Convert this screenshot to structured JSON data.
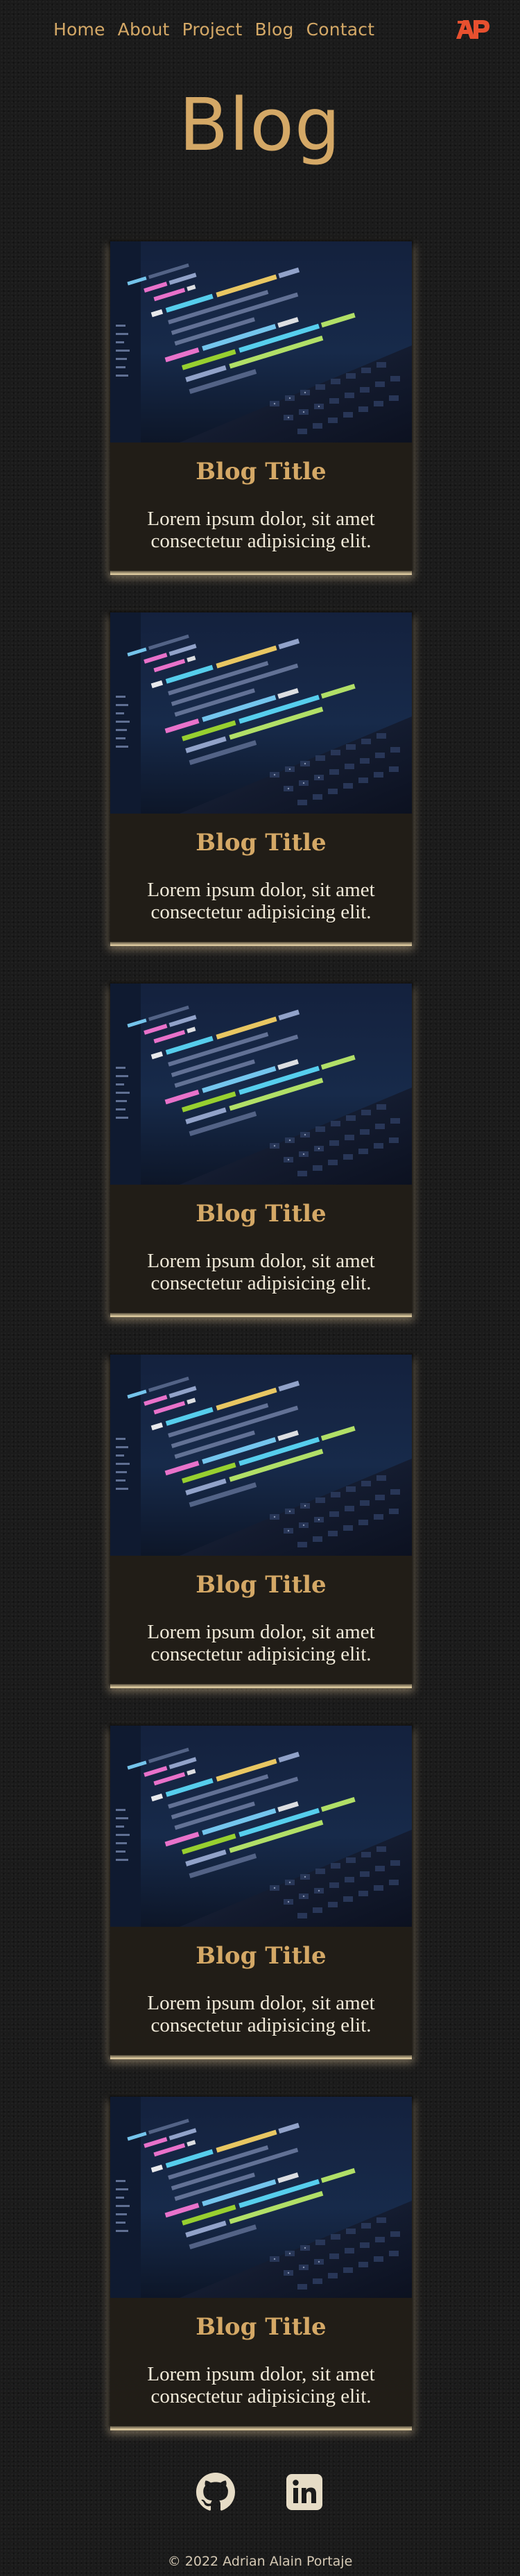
{
  "nav": {
    "items": [
      {
        "label": "Home"
      },
      {
        "label": "About"
      },
      {
        "label": "Project"
      },
      {
        "label": "Blog"
      },
      {
        "label": "Contact"
      }
    ],
    "logo_text": "AP"
  },
  "page": {
    "title": "Blog"
  },
  "posts": [
    {
      "title": "Blog Title",
      "text": "Lorem ipsum dolor, sit amet consectetur adipisicing elit."
    },
    {
      "title": "Blog Title",
      "text": "Lorem ipsum dolor, sit amet consectetur adipisicing elit."
    },
    {
      "title": "Blog Title",
      "text": "Lorem ipsum dolor, sit amet consectetur adipisicing elit."
    },
    {
      "title": "Blog Title",
      "text": "Lorem ipsum dolor, sit amet consectetur adipisicing elit."
    },
    {
      "title": "Blog Title",
      "text": "Lorem ipsum dolor, sit amet consectetur adipisicing elit."
    },
    {
      "title": "Blog Title",
      "text": "Lorem ipsum dolor, sit amet consectetur adipisicing elit."
    }
  ],
  "footer": {
    "social": [
      {
        "icon": "github-icon"
      },
      {
        "icon": "linkedin-icon"
      }
    ],
    "copyright": "© 2022 Adrian Alain Portaje"
  },
  "colors": {
    "accent": "#d4a866",
    "background": "#1b1b1b",
    "logo": "#e8502f",
    "card_glow": "#e6d2a6"
  }
}
